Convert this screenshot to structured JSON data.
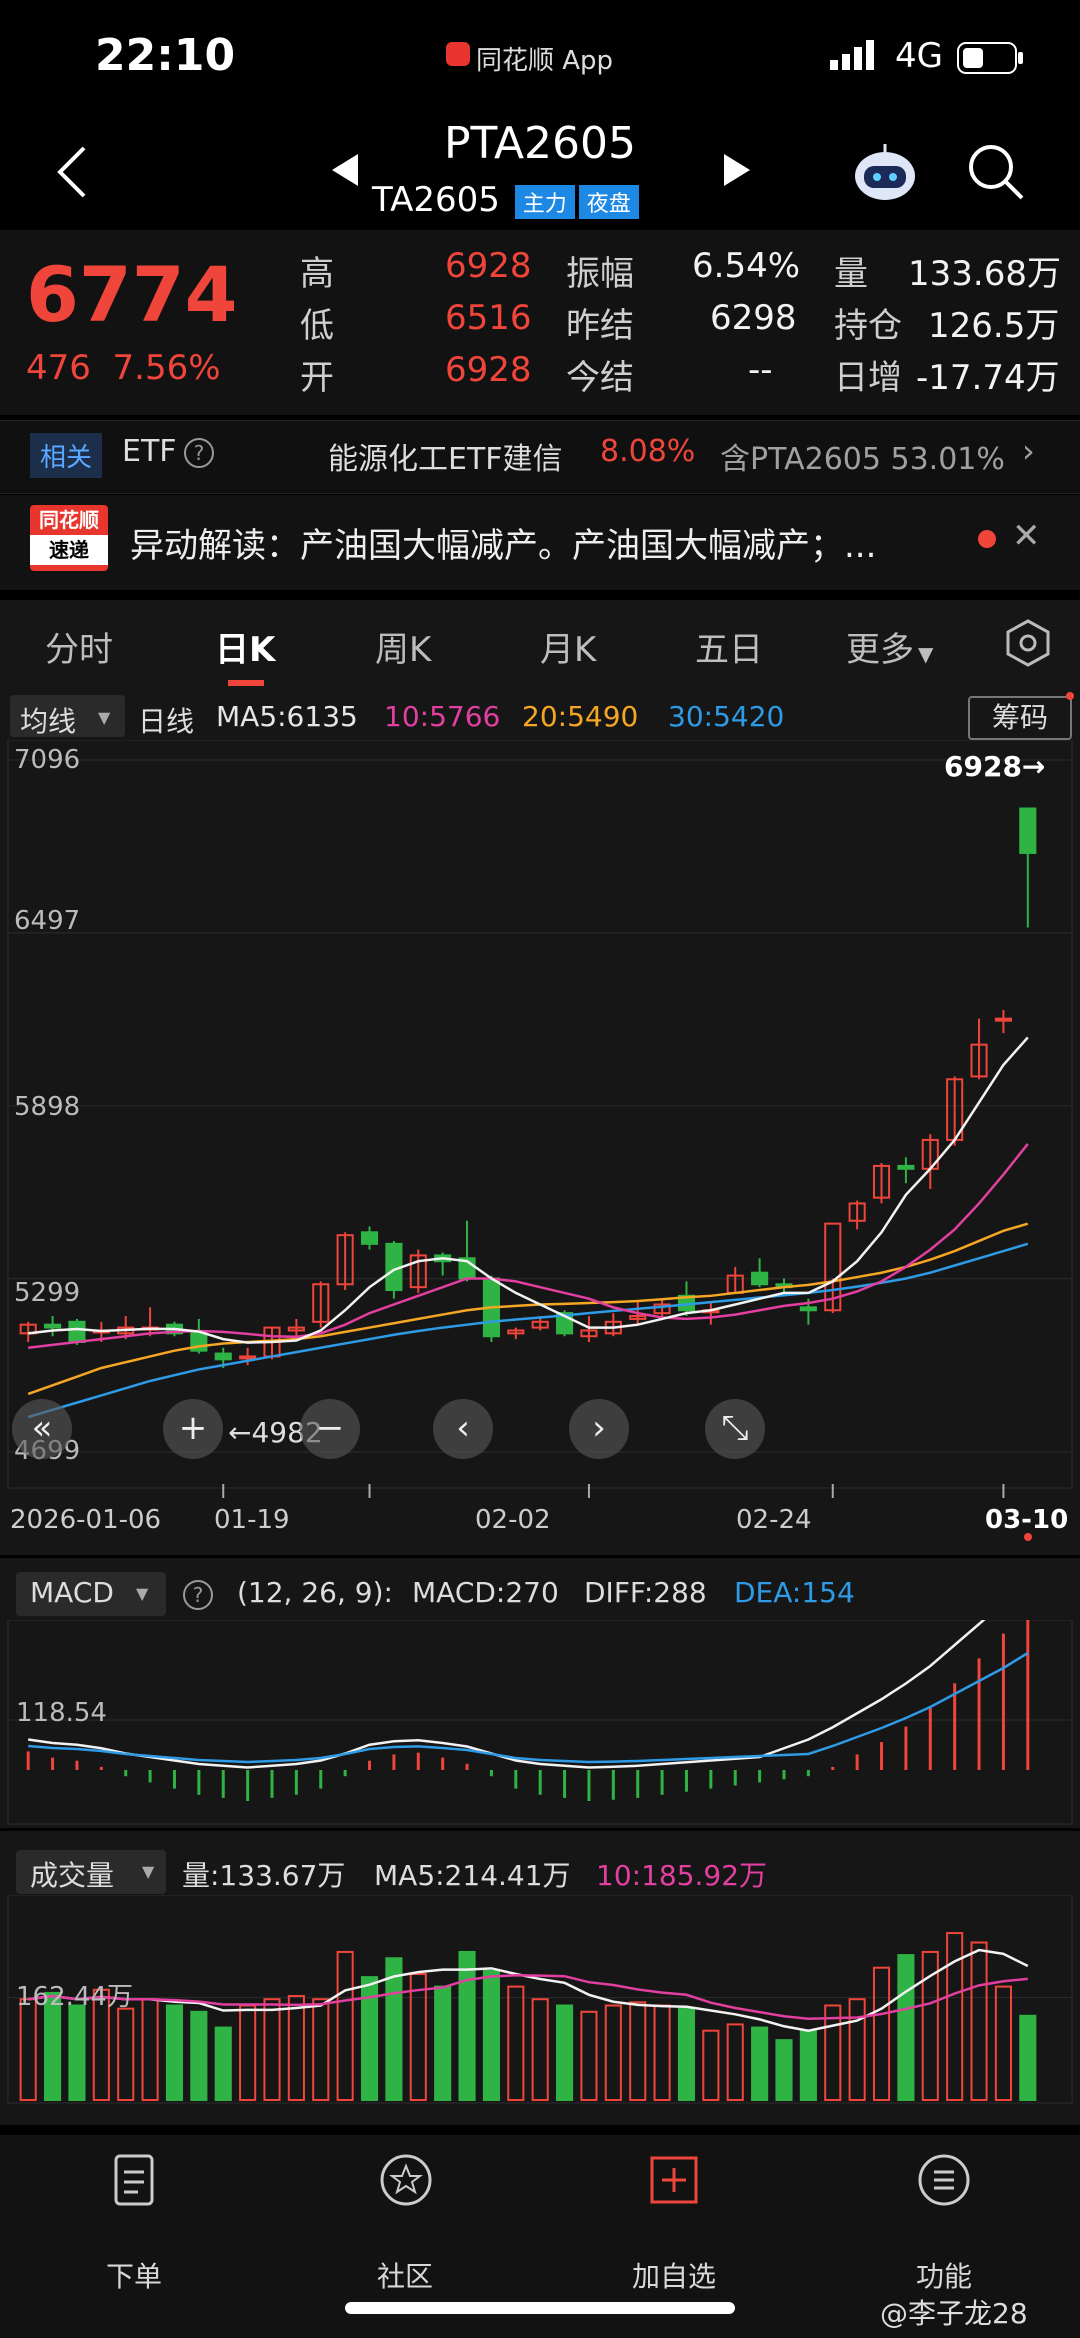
{
  "status": {
    "time": "22:10",
    "app": "同花顺 App",
    "network": "4G"
  },
  "header": {
    "title": "PTA2605",
    "subtitle": "TA2605",
    "tags": [
      "主力",
      "夜盘"
    ]
  },
  "quote": {
    "price": "6774",
    "change": "476",
    "change_pct": "7.56%",
    "col1": [
      {
        "label": "高",
        "value": "6928"
      },
      {
        "label": "低",
        "value": "6516"
      },
      {
        "label": "开",
        "value": "6928"
      }
    ],
    "col2": [
      {
        "label": "振幅",
        "value": "6.54%"
      },
      {
        "label": "昨结",
        "value": "6298"
      },
      {
        "label": "今结",
        "value": "--"
      }
    ],
    "col3": [
      {
        "label": "量",
        "value": "133.68万"
      },
      {
        "label": "持仓",
        "value": "126.5万"
      },
      {
        "label": "日增",
        "value": "-17.74万"
      }
    ]
  },
  "etf": {
    "tag": "相关",
    "label": "ETF",
    "name": "能源化工ETF建信",
    "pct": "8.08%",
    "holding": "含PTA2605 53.01%"
  },
  "news": {
    "logo_top": "同花顺",
    "logo_bottom": "速递",
    "text": "异动解读：产油国大幅减产。产油国大幅减产；..."
  },
  "tabs": [
    "分时",
    "日K",
    "周K",
    "月K",
    "五日",
    "更多"
  ],
  "active_tab": "日K",
  "ma_bar": {
    "select": "均线",
    "type": "日线",
    "ma5": "MA5:6135",
    "ma10": "10:5766",
    "ma20": "20:5490",
    "ma30": "30:5420",
    "button": "筹码"
  },
  "kline": {
    "y_labels": [
      "7096",
      "6497",
      "5898",
      "5299",
      "4699"
    ],
    "high_marker": "6928→",
    "low_marker": "←4982",
    "x_labels": [
      "2026-01-06",
      "01-19",
      "02-02",
      "02-24",
      "03-10"
    ]
  },
  "macd": {
    "select": "MACD",
    "params": "(12, 26, 9):",
    "macd": "MACD:270",
    "diff": "DIFF:288",
    "dea": "DEA:154",
    "ref": "118.54"
  },
  "volume": {
    "select": "成交量",
    "vol": "量:133.67万",
    "ma5": "MA5:214.41万",
    "ma10": "10:185.92万",
    "ref": "162.44万"
  },
  "nav": [
    "下单",
    "社区",
    "加自选",
    "功能"
  ],
  "watermark": "@李子龙28",
  "colors": {
    "up": "#f0453a",
    "down": "#2fb344",
    "ma5": "#f2f2f2",
    "ma10": "#e23fa0",
    "ma20": "#f5a623",
    "ma30": "#2e9be6"
  },
  "chart_data": {
    "type": "candlestick",
    "x_range": [
      "2026-01-06",
      "2026-03-10"
    ],
    "ylim": [
      4699,
      7096
    ],
    "candles": [
      {
        "o": 5110,
        "h": 5150,
        "l": 5080,
        "c": 5140
      },
      {
        "o": 5140,
        "h": 5170,
        "l": 5100,
        "c": 5130
      },
      {
        "o": 5150,
        "h": 5160,
        "l": 5070,
        "c": 5080
      },
      {
        "o": 5120,
        "h": 5150,
        "l": 5080,
        "c": 5120
      },
      {
        "o": 5110,
        "h": 5170,
        "l": 5090,
        "c": 5130
      },
      {
        "o": 5130,
        "h": 5200,
        "l": 5100,
        "c": 5130
      },
      {
        "o": 5140,
        "h": 5150,
        "l": 5100,
        "c": 5110
      },
      {
        "o": 5110,
        "h": 5160,
        "l": 5040,
        "c": 5050
      },
      {
        "o": 5040,
        "h": 5060,
        "l": 4990,
        "c": 5020
      },
      {
        "o": 5030,
        "h": 5060,
        "l": 5000,
        "c": 5030
      },
      {
        "o": 5030,
        "h": 5130,
        "l": 5020,
        "c": 5130
      },
      {
        "o": 5120,
        "h": 5160,
        "l": 5100,
        "c": 5130
      },
      {
        "o": 5150,
        "h": 5290,
        "l": 5130,
        "c": 5280
      },
      {
        "o": 5280,
        "h": 5460,
        "l": 5260,
        "c": 5450
      },
      {
        "o": 5460,
        "h": 5480,
        "l": 5400,
        "c": 5420
      },
      {
        "o": 5420,
        "h": 5430,
        "l": 5230,
        "c": 5260
      },
      {
        "o": 5270,
        "h": 5400,
        "l": 5250,
        "c": 5380
      },
      {
        "o": 5380,
        "h": 5390,
        "l": 5310,
        "c": 5360
      },
      {
        "o": 5370,
        "h": 5500,
        "l": 5290,
        "c": 5300
      },
      {
        "o": 5300,
        "h": 5310,
        "l": 5080,
        "c": 5100
      },
      {
        "o": 5110,
        "h": 5130,
        "l": 5090,
        "c": 5120
      },
      {
        "o": 5130,
        "h": 5170,
        "l": 5120,
        "c": 5150
      },
      {
        "o": 5180,
        "h": 5190,
        "l": 5100,
        "c": 5110
      },
      {
        "o": 5100,
        "h": 5170,
        "l": 5080,
        "c": 5120
      },
      {
        "o": 5110,
        "h": 5180,
        "l": 5100,
        "c": 5150
      },
      {
        "o": 5160,
        "h": 5220,
        "l": 5140,
        "c": 5170
      },
      {
        "o": 5180,
        "h": 5230,
        "l": 5160,
        "c": 5210
      },
      {
        "o": 5240,
        "h": 5290,
        "l": 5170,
        "c": 5190
      },
      {
        "o": 5190,
        "h": 5220,
        "l": 5140,
        "c": 5190
      },
      {
        "o": 5250,
        "h": 5340,
        "l": 5250,
        "c": 5310
      },
      {
        "o": 5320,
        "h": 5370,
        "l": 5270,
        "c": 5280
      },
      {
        "o": 5280,
        "h": 5300,
        "l": 5250,
        "c": 5270
      },
      {
        "o": 5200,
        "h": 5230,
        "l": 5140,
        "c": 5190
      },
      {
        "o": 5190,
        "h": 5300,
        "l": 5180,
        "c": 5490
      },
      {
        "o": 5500,
        "h": 5570,
        "l": 5470,
        "c": 5560
      },
      {
        "o": 5580,
        "h": 5700,
        "l": 5560,
        "c": 5690
      },
      {
        "o": 5690,
        "h": 5720,
        "l": 5630,
        "c": 5680
      },
      {
        "o": 5680,
        "h": 5800,
        "l": 5610,
        "c": 5780
      },
      {
        "o": 5780,
        "h": 6000,
        "l": 5760,
        "c": 5990
      },
      {
        "o": 6000,
        "h": 6200,
        "l": 5990,
        "c": 6110
      },
      {
        "o": 6200,
        "h": 6230,
        "l": 6150,
        "c": 6200
      },
      {
        "o": 6928,
        "h": 6928,
        "l": 6516,
        "c": 6774
      }
    ],
    "ma5": [
      5110,
      5120,
      5125,
      5118,
      5122,
      5126,
      5125,
      5116,
      5090,
      5078,
      5080,
      5085,
      5120,
      5190,
      5270,
      5330,
      5360,
      5370,
      5360,
      5300,
      5250,
      5210,
      5170,
      5130,
      5130,
      5140,
      5160,
      5180,
      5190,
      5210,
      5230,
      5250,
      5250,
      5290,
      5360,
      5460,
      5590,
      5680,
      5780,
      5910,
      6040,
      6135
    ],
    "ma10": [
      5060,
      5070,
      5080,
      5090,
      5100,
      5110,
      5115,
      5118,
      5115,
      5108,
      5100,
      5098,
      5110,
      5140,
      5180,
      5210,
      5240,
      5270,
      5300,
      5300,
      5290,
      5270,
      5250,
      5230,
      5200,
      5180,
      5165,
      5160,
      5165,
      5175,
      5190,
      5205,
      5215,
      5230,
      5255,
      5290,
      5340,
      5400,
      5470,
      5560,
      5660,
      5766
    ],
    "ma20": [
      4900,
      4930,
      4960,
      4990,
      5010,
      5030,
      5050,
      5065,
      5075,
      5080,
      5085,
      5090,
      5100,
      5115,
      5130,
      5145,
      5160,
      5175,
      5190,
      5200,
      5205,
      5210,
      5212,
      5215,
      5218,
      5222,
      5228,
      5235,
      5240,
      5250,
      5260,
      5270,
      5278,
      5290,
      5305,
      5320,
      5340,
      5365,
      5395,
      5430,
      5465,
      5490
    ],
    "ma30": [
      4820,
      4845,
      4870,
      4895,
      4920,
      4945,
      4965,
      4985,
      5000,
      5015,
      5030,
      5045,
      5060,
      5075,
      5090,
      5105,
      5118,
      5130,
      5140,
      5150,
      5158,
      5165,
      5172,
      5180,
      5188,
      5195,
      5202,
      5210,
      5218,
      5226,
      5234,
      5242,
      5250,
      5260,
      5272,
      5285,
      5300,
      5320,
      5345,
      5370,
      5395,
      5420
    ],
    "macd_hist": [
      30,
      20,
      15,
      5,
      -10,
      -20,
      -30,
      -40,
      -45,
      -50,
      -45,
      -40,
      -30,
      -10,
      15,
      25,
      28,
      20,
      10,
      -10,
      -30,
      -40,
      -45,
      -50,
      -48,
      -45,
      -40,
      -35,
      -30,
      -25,
      -20,
      -15,
      -10,
      5,
      25,
      45,
      70,
      100,
      140,
      180,
      220,
      270
    ],
    "volume": [
      160,
      170,
      150,
      175,
      145,
      160,
      150,
      140,
      115,
      150,
      160,
      165,
      160,
      235,
      195,
      225,
      200,
      180,
      235,
      205,
      180,
      160,
      150,
      140,
      150,
      155,
      150,
      145,
      110,
      120,
      115,
      95,
      110,
      150,
      160,
      210,
      230,
      235,
      265,
      250,
      180,
      133.67
    ]
  }
}
